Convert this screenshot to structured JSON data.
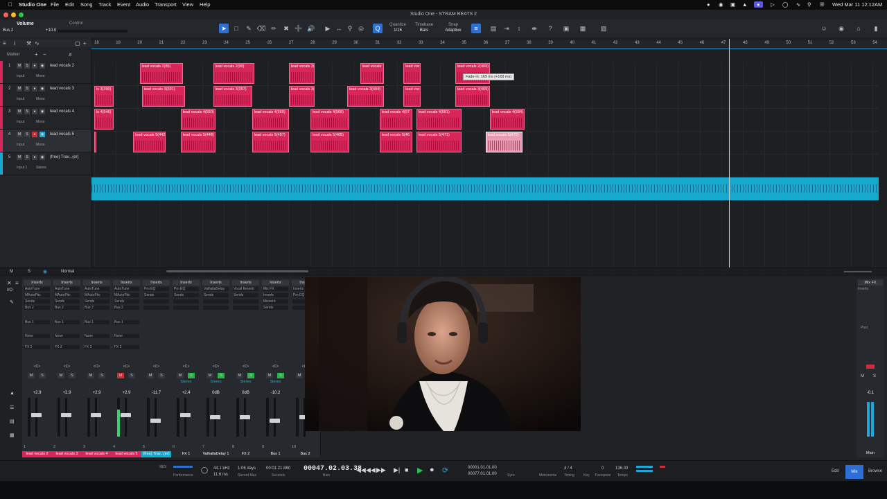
{
  "menubar": {
    "apple_icon": "apple-icon",
    "app": "Studio One",
    "items": [
      "File",
      "Edit",
      "Song",
      "Track",
      "Event",
      "Audio",
      "Transport",
      "View",
      "Help"
    ],
    "clock": "Wed Mar 11  12:12AM"
  },
  "titlebar": {
    "title": "Studio One - STRAM BEATS 2"
  },
  "toolbar": {
    "volume_label": "Volume",
    "control_label": "Control",
    "bus_label": "Bus 2",
    "volume_value": "+10.0",
    "quantize_label": "Quantize",
    "quantize_value": "1/16",
    "timebase_label": "Timebase",
    "timebase_value": "Bars",
    "snap_label": "Snap",
    "snap_value": "Adaptive"
  },
  "arrange": {
    "marker_label": "Marker",
    "bars": [
      "18",
      "19",
      "20",
      "21",
      "22",
      "23",
      "24",
      "25",
      "26",
      "27",
      "28",
      "29",
      "30",
      "31",
      "32",
      "33",
      "34",
      "35",
      "36",
      "37",
      "38",
      "39",
      "40",
      "41",
      "42",
      "43",
      "44",
      "45",
      "46",
      "47",
      "48",
      "49",
      "50",
      "51",
      "52",
      "53",
      "54"
    ],
    "tracks": [
      {
        "num": "1",
        "name": "lead vocals 2",
        "input": "Input",
        "mode": "Mono",
        "color": "#d8265a"
      },
      {
        "num": "2",
        "name": "lead vocals 3",
        "input": "Input",
        "mode": "Mono",
        "color": "#d8265a"
      },
      {
        "num": "3",
        "name": "lead vocals 4",
        "input": "Input",
        "mode": "Mono",
        "color": "#d8265a"
      },
      {
        "num": "4",
        "name": "lead vocals 5",
        "input": "Input",
        "mode": "Mono",
        "color": "#d8265a"
      },
      {
        "num": "5",
        "name": "(free) Trav...(er)",
        "input": "Input 1",
        "mode": "Stereo",
        "color": "#16a9d0"
      }
    ],
    "clips": [
      {
        "lane": 0,
        "bar": 20.1,
        "len": 2.0,
        "name": "lead vocals 2(85)"
      },
      {
        "lane": 0,
        "bar": 23.5,
        "len": 1.9,
        "name": "lead vocals 2(90)"
      },
      {
        "lane": 0,
        "bar": 27.0,
        "len": 1.2,
        "name": "lead vocals 2("
      },
      {
        "lane": 0,
        "bar": 30.3,
        "len": 1.1,
        "name": "lead vocals"
      },
      {
        "lane": 0,
        "bar": 32.3,
        "len": 0.8,
        "name": "lead voc"
      },
      {
        "lane": 0,
        "bar": 34.7,
        "len": 1.6,
        "name": "lead vocals 2(409)"
      },
      {
        "lane": 1,
        "bar": 18.0,
        "len": 0.9,
        "name": "ls 3(390)"
      },
      {
        "lane": 1,
        "bar": 20.2,
        "len": 2.0,
        "name": "lead vocals 3(391)"
      },
      {
        "lane": 1,
        "bar": 23.5,
        "len": 1.8,
        "name": "lead vocals 3(397)"
      },
      {
        "lane": 1,
        "bar": 27.0,
        "len": 1.2,
        "name": "lead vocals 3("
      },
      {
        "lane": 1,
        "bar": 29.7,
        "len": 1.7,
        "name": "lead vocals 3(404)"
      },
      {
        "lane": 1,
        "bar": 32.3,
        "len": 0.8,
        "name": "lead voc"
      },
      {
        "lane": 1,
        "bar": 34.7,
        "len": 1.6,
        "name": "lead vocals 3(409)"
      },
      {
        "lane": 2,
        "bar": 18.0,
        "len": 0.9,
        "name": "ls 4(546)"
      },
      {
        "lane": 2,
        "bar": 22.0,
        "len": 1.6,
        "name": "lead vocals 4(550)"
      },
      {
        "lane": 2,
        "bar": 25.3,
        "len": 1.7,
        "name": "lead vocals 4(560)"
      },
      {
        "lane": 2,
        "bar": 28.0,
        "len": 1.8,
        "name": "lead vocals 4(568)"
      },
      {
        "lane": 2,
        "bar": 31.2,
        "len": 1.5,
        "name": "lead vocals 4(57"
      },
      {
        "lane": 2,
        "bar": 32.9,
        "len": 2.1,
        "name": "lead vocals 4(581)"
      },
      {
        "lane": 2,
        "bar": 36.3,
        "len": 1.6,
        "name": "lead vocals 4(584)"
      },
      {
        "lane": 3,
        "bar": 18.0,
        "len": 0.1,
        "name": ""
      },
      {
        "lane": 3,
        "bar": 19.8,
        "len": 1.5,
        "name": "lead vocals 5(442)"
      },
      {
        "lane": 3,
        "bar": 22.0,
        "len": 1.6,
        "name": "lead vocals 5(448)"
      },
      {
        "lane": 3,
        "bar": 25.3,
        "len": 1.7,
        "name": "lead vocals 5(457)"
      },
      {
        "lane": 3,
        "bar": 28.0,
        "len": 1.8,
        "name": "lead vocals 5(465)"
      },
      {
        "lane": 3,
        "bar": 31.2,
        "len": 1.5,
        "name": "lead vocals 5(46"
      },
      {
        "lane": 3,
        "bar": 32.9,
        "len": 2.1,
        "name": "lead vocals 5(471)"
      },
      {
        "lane": 3,
        "bar": 36.1,
        "len": 1.7,
        "name": "lead vocals 5(472)",
        "selected": true
      }
    ],
    "tooltip": "Fade-in: 169 ms (+169 ms)",
    "foot_left": "Normal"
  },
  "mixer": {
    "channels": [
      {
        "num": "1",
        "name": "lead vocals 2",
        "slots": [
          "AutoTune",
          "MAutoPitc",
          "Sends",
          "Bus 2"
        ],
        "bus": "Bus 1",
        "none": "None",
        "fx": "FX 2",
        "value": "+2.9",
        "fader": 0.55,
        "meter": 0.0,
        "namecolor": "#d8265a"
      },
      {
        "num": "2",
        "name": "lead vocals 3",
        "slots": [
          "AutoTune",
          "MAutoPitc",
          "Sends",
          "Bus 2"
        ],
        "bus": "Bus 1",
        "none": "None",
        "fx": "FX 2",
        "value": "+2.9",
        "fader": 0.55,
        "meter": 0.0,
        "namecolor": "#d8265a"
      },
      {
        "num": "3",
        "name": "lead vocals 4",
        "slots": [
          "AutoTune",
          "MAutoPitc",
          "Sends",
          "Bus 2"
        ],
        "bus": "Bus 1",
        "none": "None",
        "fx": "FX 2",
        "value": "+2.9",
        "fader": 0.55,
        "meter": 0.0,
        "namecolor": "#d8265a"
      },
      {
        "num": "4",
        "name": "lead vocals 5",
        "slots": [
          "AutoTune",
          "MAutoPitc",
          "Sends",
          "Bus 2"
        ],
        "bus": "Bus 1",
        "none": "None",
        "fx": "FX 2",
        "value": "+2.9",
        "fader": 0.55,
        "meter": 0.7,
        "namecolor": "#d8265a"
      },
      {
        "num": "5",
        "name": "(free) Trav...(er)",
        "slots": [
          "Pro EQ",
          "Sends",
          "",
          ""
        ],
        "bus": "",
        "none": "",
        "fx": "",
        "value": "-11.7",
        "fader": 0.4,
        "meter": 0.0,
        "namecolor": "#16a9d0"
      },
      {
        "num": "6",
        "name": "FX 1",
        "slots": [
          "Pro EQ",
          "Sends",
          "",
          ""
        ],
        "bus": "",
        "none": "",
        "fx": "",
        "value": "+2.4",
        "fader": 0.55,
        "meter": 0.0,
        "stereo": "Stereo",
        "namecolor": "#26292d"
      },
      {
        "num": "7",
        "name": "ValhallaDelay 1",
        "slots": [
          "ValhallaDelay",
          "Sends",
          "",
          ""
        ],
        "bus": "",
        "none": "",
        "fx": "",
        "value": "0dB",
        "fader": 0.5,
        "meter": 0.0,
        "stereo": "Stereo",
        "namecolor": "#26292d"
      },
      {
        "num": "8",
        "name": "FX 2",
        "slots": [
          "Vocal Reverb",
          "Sends",
          "",
          ""
        ],
        "bus": "",
        "none": "",
        "fx": "",
        "value": "0dB",
        "fader": 0.5,
        "meter": 0.0,
        "stereo": "Stereo",
        "namecolor": "#26292d"
      },
      {
        "num": "9",
        "name": "Bus 1",
        "slots": [
          "Mix FX",
          "Inserts",
          "Mixverb",
          "Sends"
        ],
        "bus": "",
        "none": "",
        "fx": "",
        "value": "-10.2",
        "fader": 0.4,
        "meter": 0.0,
        "stereo": "Stereo",
        "namecolor": "#26292d"
      },
      {
        "num": "10",
        "name": "Bus 2",
        "slots": [
          "Inserts",
          "Pro EQ",
          "",
          ""
        ],
        "bus": "",
        "none": "",
        "fx": "",
        "value": "",
        "fader": 0.5,
        "meter": 0.0,
        "stereo": "",
        "namecolor": "#26292d"
      }
    ],
    "main": {
      "label": "Main",
      "value": "-0.1",
      "mixfx": "Mix FX",
      "inserts": "Inserts",
      "post": "Post"
    }
  },
  "transport": {
    "sample_rate": "44.1 kHz",
    "latency": "11.6 ms",
    "record_days": "1:06 days",
    "record_max": "Record Max",
    "seconds_label": "Seconds",
    "time_seconds": "00:01:21.880",
    "position": "00047.02.03.38",
    "bars_label": "Bars",
    "loop_start": "00001.01.01.00",
    "loop_end": "00077.01.01.00",
    "sync_label": "Sync",
    "metronome_label": "Metronome",
    "timing_label": "Timing",
    "time_sig": "4 / 4",
    "key_label": "Key",
    "transpose_label": "Transpose",
    "transpose_value": "0",
    "tempo_label": "Tempo",
    "tempo_value": "136.00",
    "midi_label": "MIDI",
    "performance_label": "Performance",
    "edit_tab": "Edit",
    "mix_tab": "Mix",
    "browse_tab": "Browse"
  }
}
